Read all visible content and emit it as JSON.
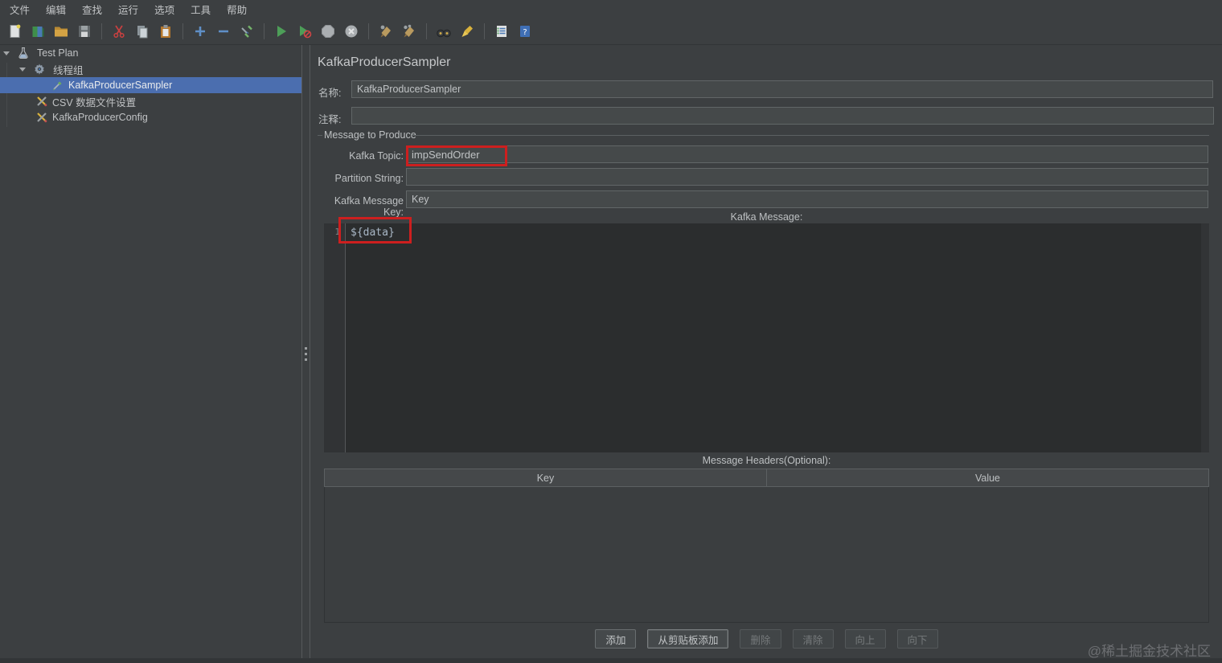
{
  "menu": {
    "items": [
      "文件",
      "编辑",
      "查找",
      "运行",
      "选项",
      "工具",
      "帮助"
    ]
  },
  "toolbar": {
    "icons": [
      "new-file",
      "open-template",
      "open-file",
      "save",
      "cut",
      "copy",
      "paste",
      "expand-add",
      "collapse-remove",
      "toggle",
      "start",
      "start-no-timers",
      "stop",
      "shutdown",
      "clear",
      "clear-all",
      "search",
      "clear-search",
      "function-helper",
      "help"
    ]
  },
  "tree": {
    "items": [
      {
        "label": "Test Plan",
        "icon": "test-plan-icon",
        "expanded": true,
        "selected": false
      },
      {
        "label": "线程组",
        "icon": "thread-group-icon",
        "expanded": true,
        "selected": false
      },
      {
        "label": "KafkaProducerSampler",
        "icon": "sampler-icon",
        "expanded": false,
        "selected": true
      },
      {
        "label": "CSV 数据文件设置",
        "icon": "config-icon",
        "expanded": false,
        "selected": false
      },
      {
        "label": "KafkaProducerConfig",
        "icon": "config-icon",
        "expanded": false,
        "selected": false
      }
    ]
  },
  "panel": {
    "title": "KafkaProducerSampler",
    "name_label": "名称:",
    "name_value": "KafkaProducerSampler",
    "comment_label": "注释:",
    "comment_value": "",
    "group_title": "Message to Produce",
    "fields": {
      "topic_label": "Kafka Topic:",
      "topic_value": "impSendOrder",
      "partition_label": "Partition String:",
      "partition_value": "",
      "key_label": "Kafka Message Key:",
      "key_value": "Key"
    },
    "message": {
      "label": "Kafka Message:",
      "line_number": "1",
      "code": "${data}"
    },
    "headers": {
      "label": "Message Headers(Optional):",
      "columns": [
        "Key",
        "Value"
      ],
      "rows": []
    },
    "buttons": [
      {
        "label": "添加",
        "enabled": true
      },
      {
        "label": "从剪贴板添加",
        "enabled": true
      },
      {
        "label": "删除",
        "enabled": false
      },
      {
        "label": "清除",
        "enabled": false
      },
      {
        "label": "向上",
        "enabled": false
      },
      {
        "label": "向下",
        "enabled": false
      }
    ]
  },
  "watermark": "@稀土掘金技术社区",
  "colors": {
    "selection": "#4b6eaf",
    "annotation_red": "#cd1f1f",
    "panel_bg": "#3c3f41",
    "editor_bg": "#2b2d2e",
    "input_bg": "#45494a",
    "start_green": "#4d9e58"
  }
}
